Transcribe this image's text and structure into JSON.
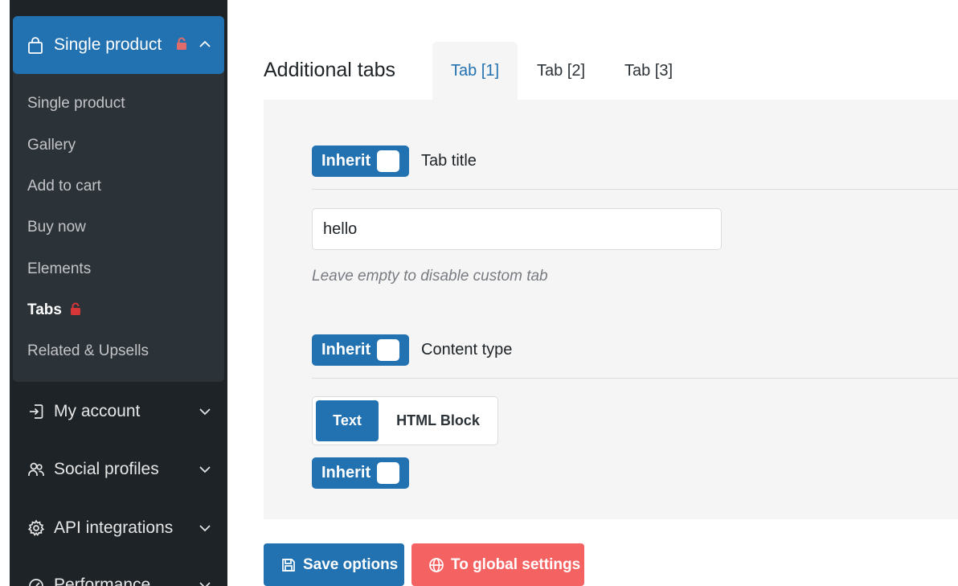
{
  "sidebar": {
    "group": {
      "label": "Single product",
      "locked": true,
      "expanded": true
    },
    "sub_items": [
      {
        "label": "Single product"
      },
      {
        "label": "Gallery"
      },
      {
        "label": "Add to cart"
      },
      {
        "label": "Buy now"
      },
      {
        "label": "Elements"
      },
      {
        "label": "Tabs",
        "active": true,
        "locked": true
      },
      {
        "label": "Related & Upsells"
      }
    ],
    "items": [
      {
        "label": "My account",
        "icon": "sign-in-icon"
      },
      {
        "label": "Social profiles",
        "icon": "users-icon"
      },
      {
        "label": "API integrations",
        "icon": "gear-icon"
      },
      {
        "label": "Performance",
        "icon": "gauge-icon"
      }
    ]
  },
  "main": {
    "title": "Additional tabs",
    "tabs": [
      {
        "label": "Tab [1]",
        "active": true
      },
      {
        "label": "Tab [2]"
      },
      {
        "label": "Tab [3]"
      }
    ],
    "fields": {
      "tab_title": {
        "toggle_label": "Inherit",
        "label": "Tab title",
        "value": "hello",
        "hint": "Leave empty to disable custom tab"
      },
      "content_type": {
        "toggle_label": "Inherit",
        "label": "Content type",
        "options": [
          "Text",
          "HTML Block"
        ],
        "selected": "Text"
      },
      "extra_toggle": {
        "toggle_label": "Inherit"
      }
    },
    "buttons": {
      "save": "Save options",
      "global": "To global settings"
    }
  },
  "colors": {
    "accent": "#2271b1",
    "danger": "#f56262",
    "lock": "#d63638",
    "sidebar_bg": "#1d2327"
  }
}
